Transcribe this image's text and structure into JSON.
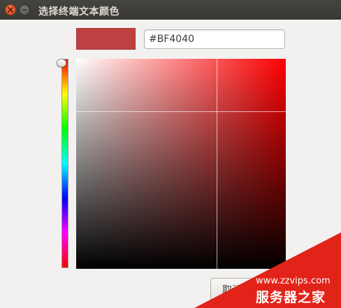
{
  "window": {
    "title": "选择终端文本颜色",
    "close_icon": "close-icon",
    "minimize_icon": "minimize-icon"
  },
  "color": {
    "hex_value": "#BF4040",
    "swatch_color": "#bf4040",
    "hue_color": "#ff0000"
  },
  "hue_slider": {
    "hue_degrees": 0
  },
  "sv_plane": {
    "saturation": 0.67,
    "value": 0.75
  },
  "buttons": {
    "cancel_label": "取消"
  },
  "watermark": {
    "url": "www.zzvips.com",
    "brand": "服务器之家",
    "color": "#e2231a"
  }
}
